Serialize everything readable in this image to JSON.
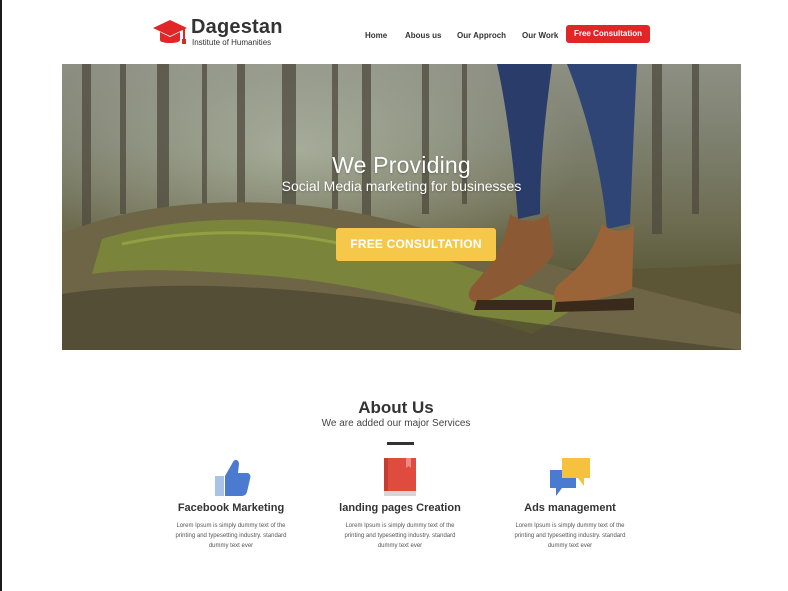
{
  "logo": {
    "name": "Dagestan",
    "tagline": "Institute of Humanities",
    "icon": "graduation-cap-icon"
  },
  "nav": {
    "items": [
      {
        "label": "Home"
      },
      {
        "label": "Abous us"
      },
      {
        "label": "Our Approch"
      },
      {
        "label": "Our Work"
      }
    ],
    "cta_label": "Free Consultation"
  },
  "hero": {
    "title": "We Providing",
    "subtitle": "Social Media marketing for businesses",
    "cta_label": "FREE CONSULTATION"
  },
  "about": {
    "title": "About Us",
    "subtitle": "We are added our major Services",
    "services": [
      {
        "icon": "thumbs-up-icon",
        "title": "Facebook Marketing",
        "text": "Lorem Ipsum is simply dummy text of the printing and typesetting industry. standard dummy text ever"
      },
      {
        "icon": "book-icon",
        "title": "landing pages Creation",
        "text": "Lorem Ipsum is simply dummy text of the printing and typesetting industry. standard dummy text ever"
      },
      {
        "icon": "chat-bubbles-icon",
        "title": "Ads management",
        "text": "Lorem Ipsum is simply dummy text of the printing and typesetting industry. standard dummy text ever"
      }
    ]
  },
  "colors": {
    "brand_red": "#e02626",
    "cta_yellow": "#f6c84a",
    "text_dark": "#333333"
  }
}
